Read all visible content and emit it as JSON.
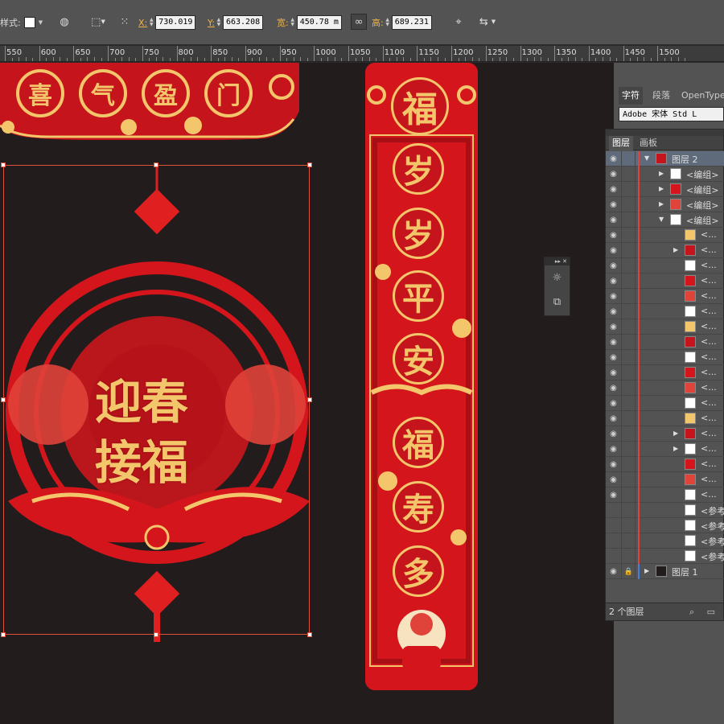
{
  "control_bar": {
    "style_label": "样式:",
    "x_label": "X:",
    "x_value": "730.019",
    "y_label": "Y:",
    "y_value": "663.208",
    "w_label": "宽:",
    "w_value": "450.78 m",
    "h_label": "高:",
    "h_value": "689.231"
  },
  "ruler": {
    "ticks": [
      "550",
      "600",
      "650",
      "700",
      "750",
      "800",
      "850",
      "900",
      "950",
      "1000",
      "1050",
      "1100",
      "1150",
      "1200",
      "1250",
      "1300",
      "1350",
      "1400",
      "1450",
      "1500"
    ]
  },
  "char_panel": {
    "tabs": [
      "字符",
      "段落",
      "OpenType"
    ],
    "font_value": "Adobe 宋体 Std L"
  },
  "layers_panel": {
    "tabs": [
      "图层",
      "画板"
    ],
    "rows": [
      {
        "name": "图层 2",
        "kind": "layer",
        "expanded": true,
        "selected": true
      },
      {
        "name": "<编组>",
        "kind": "group",
        "expanded": false
      },
      {
        "name": "<编组>",
        "kind": "group",
        "expanded": false
      },
      {
        "name": "<编组>",
        "kind": "group",
        "expanded": false
      },
      {
        "name": "<编组>",
        "kind": "group",
        "expanded": true
      },
      {
        "name": "<...",
        "kind": "item"
      },
      {
        "name": "<...",
        "kind": "item",
        "has_children": true
      },
      {
        "name": "<...",
        "kind": "item"
      },
      {
        "name": "<...",
        "kind": "item"
      },
      {
        "name": "<...",
        "kind": "item"
      },
      {
        "name": "<...",
        "kind": "item"
      },
      {
        "name": "<...",
        "kind": "item"
      },
      {
        "name": "<...",
        "kind": "item"
      },
      {
        "name": "<...",
        "kind": "item"
      },
      {
        "name": "<...",
        "kind": "item"
      },
      {
        "name": "<...",
        "kind": "item"
      },
      {
        "name": "<...",
        "kind": "item"
      },
      {
        "name": "<...",
        "kind": "item"
      },
      {
        "name": "<...",
        "kind": "item",
        "has_children": true
      },
      {
        "name": "<...",
        "kind": "item",
        "has_children": true
      },
      {
        "name": "<...",
        "kind": "item"
      },
      {
        "name": "<...",
        "kind": "item"
      },
      {
        "name": "<...",
        "kind": "item"
      },
      {
        "name": "<参考...",
        "kind": "ref"
      },
      {
        "name": "<参考...",
        "kind": "ref"
      },
      {
        "name": "<参考...",
        "kind": "ref"
      },
      {
        "name": "<参考...",
        "kind": "ref"
      },
      {
        "name": "图层 1",
        "kind": "layer",
        "expanded": false,
        "locked": true
      }
    ],
    "footer_label": "2 个图层"
  },
  "artwork": {
    "banner_chars": [
      "喜",
      "气",
      "盈",
      "门"
    ],
    "couplet_chars": [
      "岁",
      "岁",
      "平",
      "安",
      "福",
      "寿",
      "多"
    ],
    "couplet_top": "福",
    "ornament_line1": "迎春",
    "ornament_line2": "接福"
  },
  "colors": {
    "canvas": "#231c1c",
    "art_red": "#c5141b",
    "art_gold": "#f4c66b",
    "accent_orange": "#f0b34a"
  }
}
